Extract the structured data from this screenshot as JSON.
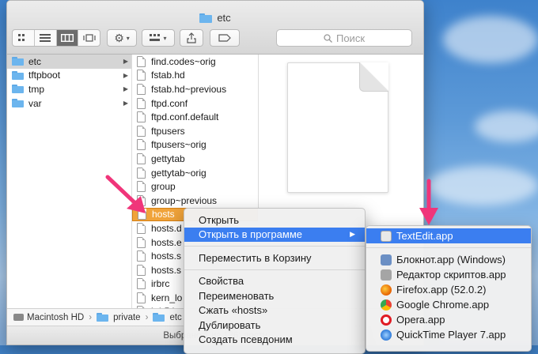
{
  "window": {
    "title": "etc"
  },
  "toolbar": {
    "search_placeholder": "Поиск"
  },
  "sidebar_col": {
    "items": [
      {
        "label": "etc",
        "selected": true
      },
      {
        "label": "tftpboot"
      },
      {
        "label": "tmp"
      },
      {
        "label": "var"
      }
    ]
  },
  "files_col": {
    "items": [
      "find.codes~orig",
      "fstab.hd",
      "fstab.hd~previous",
      "ftpd.conf",
      "ftpd.conf.default",
      "ftpusers",
      "ftpusers~orig",
      "gettytab",
      "gettytab~orig",
      "group",
      "group~previous",
      "hosts",
      "hosts.d",
      "hosts.e",
      "hosts.s",
      "hosts.s",
      "irbrc",
      "kern_lo",
      "krb5.k"
    ],
    "selected_index": 11
  },
  "pathbar": {
    "items": [
      "Macintosh HD",
      "private",
      "etc"
    ]
  },
  "status": {
    "text": "Выбрано 1 из 126; досту"
  },
  "context_menu": {
    "items": [
      "Открыть",
      "Открыть в программе",
      "Переместить в Корзину",
      "Свойства",
      "Переименовать",
      "Сжать «hosts»",
      "Дублировать",
      "Создать псевдоним"
    ]
  },
  "submenu": {
    "items": [
      {
        "label": "TextEdit.app",
        "icon": "textedit-icon",
        "color": "#d9d9d9"
      },
      {
        "label": "Блокнот.app (Windows)",
        "icon": "notepad-icon",
        "color": "#6b8fc4"
      },
      {
        "label": "Редактор скриптов.app",
        "icon": "script-editor-icon",
        "color": "#9b9b9b"
      },
      {
        "label": "Firefox.app (52.0.2)",
        "icon": "firefox-icon",
        "color": "#e66000"
      },
      {
        "label": "Google Chrome.app",
        "icon": "chrome-icon",
        "color": "#34a853"
      },
      {
        "label": "Opera.app",
        "icon": "opera-icon",
        "color": "#e01c24"
      },
      {
        "label": "QuickTime Player 7.app",
        "icon": "quicktime-icon",
        "color": "#2f7bd9"
      }
    ]
  },
  "colors": {
    "accent": "#3b7ef0",
    "selection_orange": "#f0a33a",
    "arrow_pink": "#f0357a"
  }
}
